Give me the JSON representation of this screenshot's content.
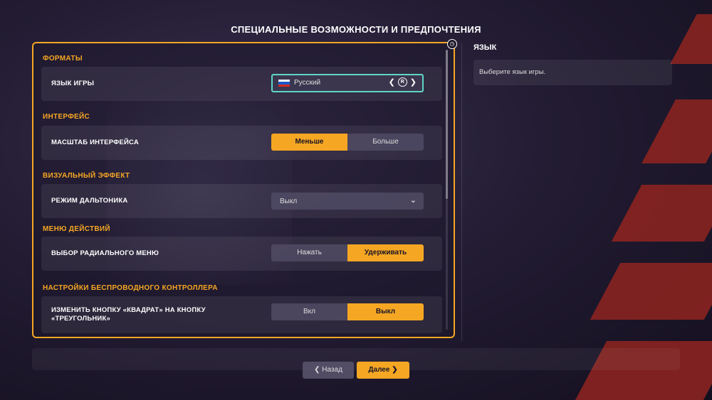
{
  "page_title": "СПЕЦИАЛЬНЫЕ ВОЗМОЖНОСТИ И ПРЕДПОЧТЕНИЯ",
  "sections": [
    {
      "title": "ФОРМАТЫ"
    },
    {
      "title": "ИНТЕРФЕЙС"
    },
    {
      "title": "ВИЗУАЛЬНЫЙ ЭФФЕКТ"
    },
    {
      "title": "МЕНЮ ДЕЙСТВИЙ"
    },
    {
      "title": "НАСТРОЙКИ БЕСПРОВОДНОГО КОНТРОЛЛЕРА"
    }
  ],
  "language": {
    "label": "ЯЗЫК ИГРЫ",
    "value": "Русский",
    "prev_icon": "chevron-left-icon",
    "next_icon": "chevron-right-icon",
    "r_button": "R"
  },
  "ui_scale": {
    "label": "МАСШТАБ ИНТЕРФЕЙСА",
    "options": [
      "Меньше",
      "Больше"
    ],
    "selected": "Меньше"
  },
  "colorblind": {
    "label": "РЕЖИМ ДАЛЬТОНИКА",
    "value": "Выкл"
  },
  "radial_menu": {
    "label": "ВЫБОР РАДИАЛЬНОГО МЕНЮ",
    "options": [
      "Нажать",
      "Удерживать"
    ],
    "selected": "Удерживать"
  },
  "swap_square_triangle": {
    "label": "ИЗМЕНИТЬ КНОПКУ «КВАДРАТ» НА КНОПКУ «ТРЕУГОЛЬНИК»",
    "options": [
      "Вкл",
      "Выкл"
    ],
    "selected": "Выкл"
  },
  "sidebar": {
    "title": "ЯЗЫК",
    "description": "Выберите язык игры."
  },
  "footer": {
    "back_label": "Назад",
    "next_label": "Далее"
  },
  "colors": {
    "accent": "#f5a623",
    "focus": "#5fd6c7",
    "stripe": "#8a2420"
  }
}
